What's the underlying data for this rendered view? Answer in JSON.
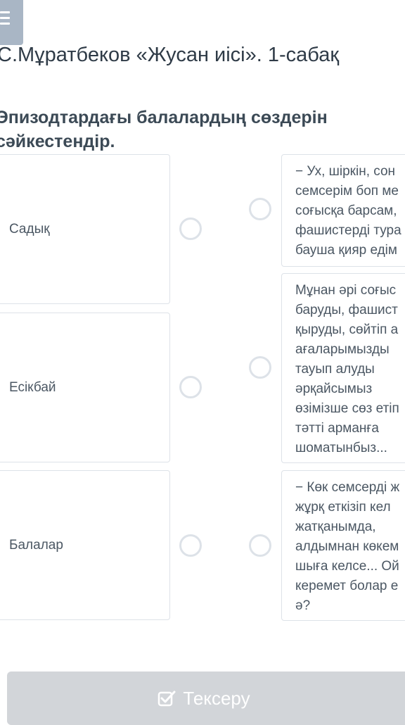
{
  "header": {
    "title": "С.Мұратбеков «Жусан иісі». 1-сабақ"
  },
  "question": {
    "text": "Эпизодтардағы балалардың сөздерін сәйкестендір."
  },
  "left_items": [
    {
      "label": "Садық"
    },
    {
      "label": "Есікбай"
    },
    {
      "label": "Балалар"
    }
  ],
  "right_items": [
    {
      "lines": [
        "− Ух, шіркін, сон",
        "семсерім боп ме",
        "соғысқа барсам,",
        "фашистерді тура",
        "бауша қияр едім"
      ]
    },
    {
      "lines": [
        "Мұнан әрі соғыс",
        "баруды, фашист",
        "қыруды, сөйтіп а",
        "ағаларымызды",
        "тауып алуды",
        "әрқайсымыз",
        "өзімізше сөз етіп",
        "тәтті арманға",
        "шоматынбыз..."
      ]
    },
    {
      "lines": [
        "− Көк семсерді ж",
        "жұрқ еткізіп кел",
        "жатқанымда,",
        "алдымнан көкем",
        "шыға келсе... Ой",
        "керемет болар е",
        "ә?"
      ]
    }
  ],
  "footer": {
    "check_label": "Тексеру",
    "check_icon": "checkbox-check-icon"
  }
}
